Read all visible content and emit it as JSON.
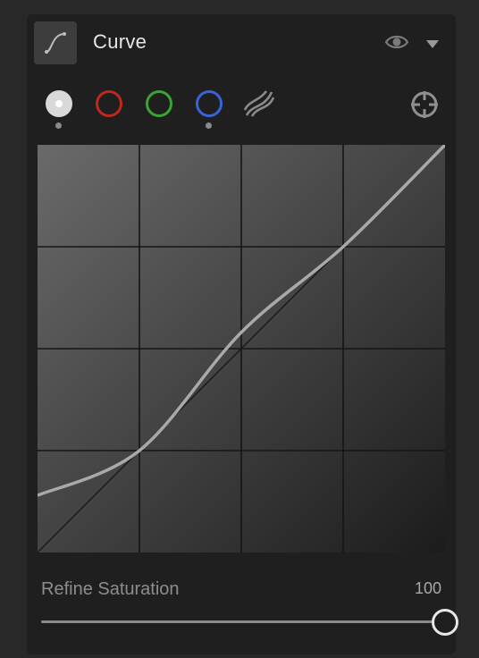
{
  "panel": {
    "title": "Curve",
    "icons": {
      "header": "curve-icon",
      "visibility": "eye-icon",
      "collapse": "chevron-down-icon",
      "target": "target-adjustment-icon"
    }
  },
  "channels": [
    {
      "name": "luminance",
      "color": "#e0e0e0",
      "selected": true,
      "adjusted": true
    },
    {
      "name": "red",
      "color": "#c0281f",
      "selected": false,
      "adjusted": false
    },
    {
      "name": "green",
      "color": "#3aa534",
      "selected": false,
      "adjusted": false
    },
    {
      "name": "blue",
      "color": "#3a63d8",
      "selected": false,
      "adjusted": true
    },
    {
      "name": "parametric",
      "color": "#8a8a8a",
      "selected": false,
      "adjusted": false
    }
  ],
  "curve": {
    "grid_divisions": 4,
    "points": [
      [
        0,
        0.14
      ],
      [
        0.25,
        0.25
      ],
      [
        0.5,
        0.54
      ],
      [
        0.75,
        0.75
      ],
      [
        1,
        1
      ]
    ]
  },
  "refine_saturation": {
    "label": "Refine Saturation",
    "value": "100",
    "level": 1.0
  }
}
